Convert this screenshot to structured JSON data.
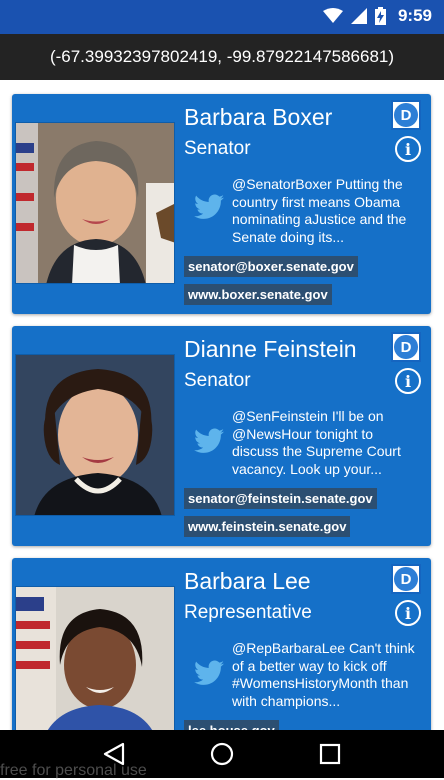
{
  "status_bar": {
    "time": "9:59",
    "accent": "#1a52b0"
  },
  "coordinates": "(-67.3993239780241​9, -99.87922147586681)",
  "cards": [
    {
      "name": "Barbara Boxer",
      "role": "Senator",
      "party": "D",
      "tweet": "@SenatorBoxer Putting the country first means Obama nominating aJustice and the Senate doing its...",
      "email": "senator@boxer.senate.gov",
      "website": "www.boxer.senate.gov"
    },
    {
      "name": "Dianne Feinstein",
      "role": "Senator",
      "party": "D",
      "tweet": "@SenFeinstein I'll be on @NewsHour tonight to discuss the Supreme Court vacancy. Look up your...",
      "email": "senator@feinstein.senate.gov",
      "website": "www.feinstein.senate.gov"
    },
    {
      "name": "Barbara Lee",
      "role": "Representative",
      "party": "D",
      "tweet": "@RepBarbaraLee Can't think of a better way to kick off #WomensHistoryMonth than with champions...",
      "email": "lee.house.gov",
      "website": ""
    }
  ],
  "watermark": "free for personal use",
  "colors": {
    "card": "#1570c8",
    "contact_bg": "#2c4f72",
    "nav": "#000000"
  }
}
